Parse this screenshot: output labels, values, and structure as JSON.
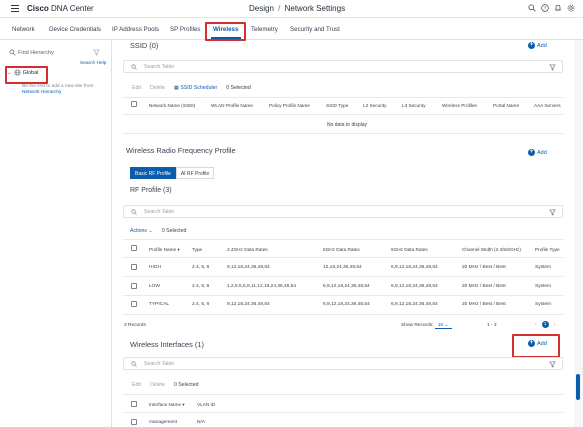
{
  "header": {
    "brand_bold": "Cisco",
    "brand_rest": " DNA Center",
    "crumb_section": "Design",
    "crumb_sep": "/",
    "crumb_page": "Network Settings",
    "icons": [
      "search-icon",
      "help-icon",
      "notifications-icon",
      "settings-icon"
    ]
  },
  "tabs": [
    "Network",
    "Device Credentials",
    "IP Address Pools",
    "SP Profiles",
    "Wireless",
    "Telemetry",
    "Security and Trust"
  ],
  "active_tab": "Wireless",
  "left": {
    "search_placeholder": "Find Hierarchy",
    "search_help": "Search Help",
    "root_label": "Global",
    "hint_text": "Be the first to add a new site from",
    "hint_link": "Network Hierarchy"
  },
  "ssid": {
    "title": "SSID (0)",
    "add": "Add",
    "search_placeholder": "Search Table",
    "edit": "Edit",
    "delete": "Delete",
    "scheduler": "SSID Scheduler",
    "selected": "0 Selected",
    "columns": [
      "Network Name (SSID)",
      "WLAN Profile Name",
      "Policy Profile Name",
      "SSID Type",
      "L2 Security",
      "L3 Security",
      "Wireless Profiles",
      "Portal Name",
      "AAA Servers"
    ],
    "empty": "No data to display"
  },
  "rf": {
    "title": "Wireless Radio Frequency Profile",
    "add": "Add",
    "toggle": [
      "Basic RF Profile",
      "AI RF Profile"
    ],
    "subtitle": "RF Profile (3)",
    "search_placeholder": "Search Table",
    "actions": "Actions",
    "selected": "0 Selected",
    "columns": [
      "Profile Name",
      "Type",
      "2.4GHz Data Rates",
      "5GHz Data Rates",
      "6GHz Data Rates",
      "Channel Width (2.4/5/6GHz)",
      "Profile Type"
    ],
    "rows": [
      [
        "HIGH",
        "2.4, 5, 6",
        "9,12,18,24,36,48,54",
        "12,18,24,36,48,54",
        "6,9,12,18,24,36,48,54",
        "20 MHz / Best / Best",
        "System"
      ],
      [
        "LOW",
        "2.4, 5, 6",
        "1,2,5.5,6,9,11,12,18,24,36,48,54",
        "6,9,12,18,24,36,48,54",
        "6,9,12,18,24,36,48,54",
        "20 MHz / Best / Best",
        "System"
      ],
      [
        "TYPICAL",
        "2.4, 5, 6",
        "9,12,18,24,36,48,54",
        "6,9,12,18,24,36,48,54",
        "6,9,12,18,24,36,48,54",
        "20 MHz / Best / Best",
        "System"
      ]
    ],
    "records": "3 Records",
    "show_records_label": "Show Records:",
    "show_records_value": "10",
    "range": "1 - 3",
    "page": "1"
  },
  "wi": {
    "title": "Wireless Interfaces (1)",
    "add": "Add",
    "search_placeholder": "Search Table",
    "edit": "Edit",
    "delete": "Delete",
    "selected": "0 Selected",
    "columns": [
      "Interface Name",
      "VLAN ID"
    ],
    "rows": [
      [
        "management",
        "N/A"
      ]
    ]
  },
  "colors": {
    "accent": "#0b5cad",
    "highlight": "#d32f2f"
  }
}
